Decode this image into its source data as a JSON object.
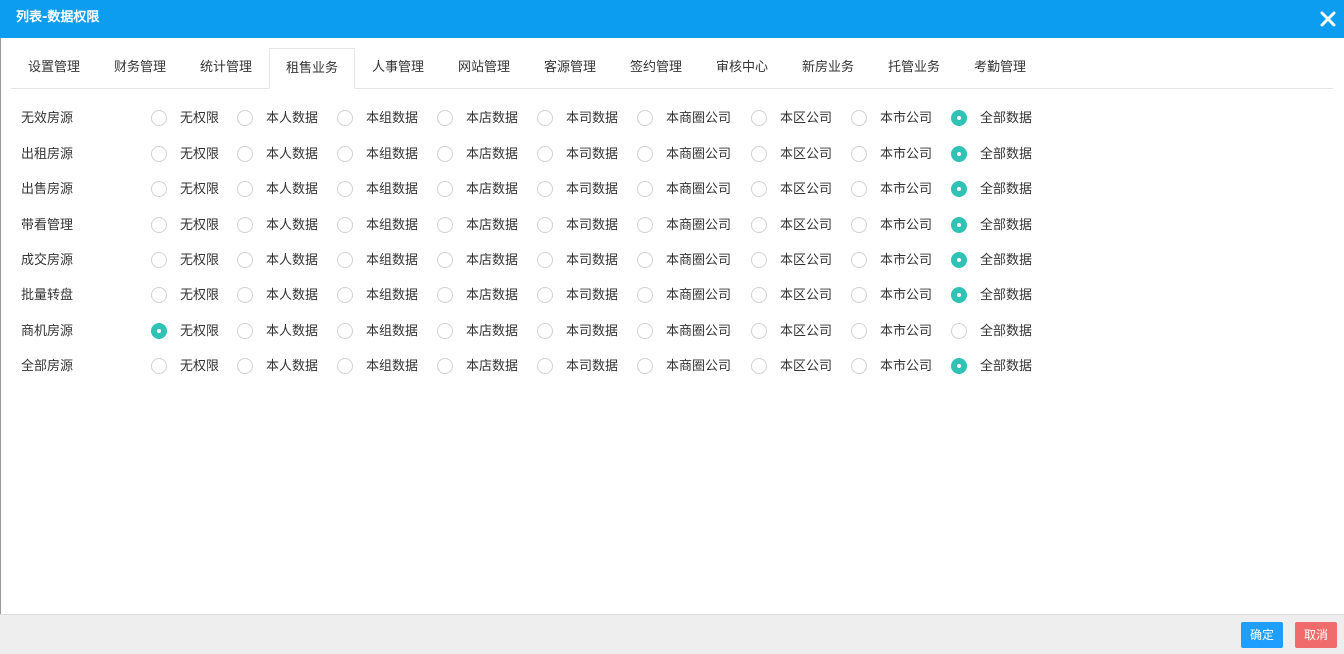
{
  "dialog": {
    "title": "列表-数据权限",
    "close_icon": "close-icon"
  },
  "tabs": [
    {
      "label": "设置管理",
      "active": false
    },
    {
      "label": "财务管理",
      "active": false
    },
    {
      "label": "统计管理",
      "active": false
    },
    {
      "label": "租售业务",
      "active": true
    },
    {
      "label": "人事管理",
      "active": false
    },
    {
      "label": "网站管理",
      "active": false
    },
    {
      "label": "客源管理",
      "active": false
    },
    {
      "label": "签约管理",
      "active": false
    },
    {
      "label": "审核中心",
      "active": false
    },
    {
      "label": "新房业务",
      "active": false
    },
    {
      "label": "托管业务",
      "active": false
    },
    {
      "label": "考勤管理",
      "active": false
    }
  ],
  "options": [
    "无权限",
    "本人数据",
    "本组数据",
    "本店数据",
    "本司数据",
    "本商圈公司",
    "本区公司",
    "本市公司",
    "全部数据"
  ],
  "rows": [
    {
      "label": "无效房源",
      "selected": 8
    },
    {
      "label": "出租房源",
      "selected": 8
    },
    {
      "label": "出售房源",
      "selected": 8
    },
    {
      "label": "带看管理",
      "selected": 8
    },
    {
      "label": "成交房源",
      "selected": 8
    },
    {
      "label": "批量转盘",
      "selected": 8
    },
    {
      "label": "商机房源",
      "selected": 0
    },
    {
      "label": "全部房源",
      "selected": 8
    }
  ],
  "footer": {
    "confirm_label": "确定",
    "cancel_label": "取消"
  },
  "colors": {
    "header": "#0c9cf0",
    "radio_checked": "#2fc2b5",
    "confirm": "#1e9fff",
    "cancel": "#f06b6b"
  }
}
